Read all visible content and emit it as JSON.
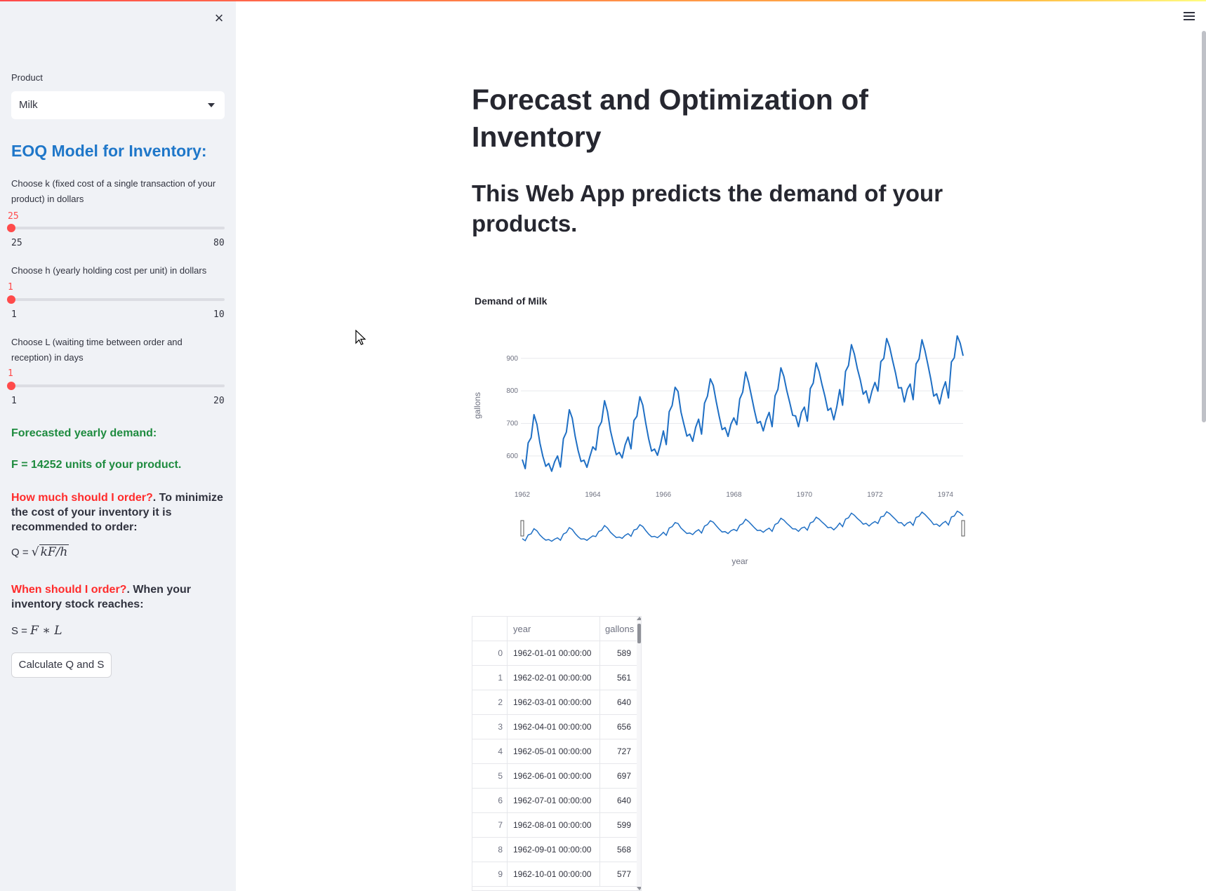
{
  "sidebar": {
    "close_icon": "×",
    "product_label": "Product",
    "product_value": "Milk",
    "eoq_title": "EOQ Model for Inventory:",
    "k_label": "Choose k (fixed cost of a single transaction of your product) in dollars",
    "k_value": "25",
    "k_min": "25",
    "k_max": "80",
    "h_label": "Choose h (yearly holding cost per unit) in dollars",
    "h_value": "1",
    "h_min": "1",
    "h_max": "10",
    "l_label": "Choose L (waiting time between order and reception) in days",
    "l_value": "1",
    "l_min": "1",
    "l_max": "20",
    "forecast_label": "Forecasted yearly demand:",
    "forecast_value": "F = 14252 units of your product.",
    "how_red": "How much should I order?",
    "how_rest": ". To minimize the cost of your inventory it is recommended to order:",
    "q_prefix": "Q = ",
    "q_formula": "kF/h",
    "when_red": "When should I order?",
    "when_rest": ". When your inventory stock reaches:",
    "s_prefix": "S = ",
    "s_formula": "F ∗ L",
    "calc_button": "Calculate Q and S"
  },
  "main": {
    "title": "Forecast and Optimization of Inventory",
    "subtitle": "This Web App predicts the demand of your products."
  },
  "colors": {
    "accent": "#ff4b4b",
    "line": "#1f6fc4",
    "eoq_title": "#1f77c9",
    "green": "#1e8b3f",
    "red": "#ff2b2b"
  },
  "icons": [
    "close-icon",
    "hamburger-menu-icon",
    "caret-down-icon",
    "mouse-cursor-icon"
  ],
  "chart_data": {
    "type": "line",
    "title": "Demand of Milk",
    "xlabel": "year",
    "ylabel": "gallons",
    "x_ticks": [
      "1962",
      "1964",
      "1966",
      "1968",
      "1970",
      "1972",
      "1974"
    ],
    "y_ticks": [
      "600",
      "700",
      "800",
      "900"
    ],
    "ylim": [
      548,
      975
    ],
    "grid": true,
    "range_slider": true,
    "x_start": "1962-01",
    "x_end": "1974-06",
    "series": [
      {
        "values": [
          589,
          561,
          640,
          656,
          727,
          697,
          640,
          599,
          568,
          577,
          553,
          582,
          600,
          566,
          653,
          673,
          742,
          716,
          660,
          617,
          583,
          587,
          565,
          598,
          628,
          618,
          688,
          705,
          770,
          736,
          678,
          639,
          604,
          611,
          594,
          634,
          658,
          622,
          709,
          722,
          782,
          756,
          702,
          653,
          615,
          621,
          602,
          635,
          677,
          635,
          736,
          755,
          811,
          798,
          735,
          697,
          661,
          667,
          645,
          688,
          713,
          667,
          762,
          784,
          837,
          817,
          767,
          722,
          681,
          687,
          660,
          698,
          717,
          696,
          775,
          796,
          858,
          826,
          783,
          740,
          701,
          706,
          677,
          711,
          734,
          690,
          785,
          805,
          871,
          845,
          801,
          764,
          725,
          723,
          690,
          734,
          750,
          707,
          807,
          824,
          886,
          859,
          819,
          783,
          740,
          747,
          711,
          751,
          804,
          756,
          860,
          878,
          942,
          913,
          869,
          834,
          790,
          800,
          763,
          800,
          826,
          799,
          890,
          900,
          961,
          935,
          894,
          855,
          809,
          810,
          766,
          805,
          821,
          773,
          883,
          898,
          957,
          924,
          881,
          837,
          784,
          791,
          760,
          802,
          828,
          778,
          889,
          902,
          969,
          947,
          908
        ]
      }
    ]
  },
  "table": {
    "headers": [
      "",
      "year",
      "gallons"
    ],
    "rows": [
      [
        "0",
        "1962-01-01 00:00:00",
        "589"
      ],
      [
        "1",
        "1962-02-01 00:00:00",
        "561"
      ],
      [
        "2",
        "1962-03-01 00:00:00",
        "640"
      ],
      [
        "3",
        "1962-04-01 00:00:00",
        "656"
      ],
      [
        "4",
        "1962-05-01 00:00:00",
        "727"
      ],
      [
        "5",
        "1962-06-01 00:00:00",
        "697"
      ],
      [
        "6",
        "1962-07-01 00:00:00",
        "640"
      ],
      [
        "7",
        "1962-08-01 00:00:00",
        "599"
      ],
      [
        "8",
        "1962-09-01 00:00:00",
        "568"
      ],
      [
        "9",
        "1962-10-01 00:00:00",
        "577"
      ]
    ]
  }
}
